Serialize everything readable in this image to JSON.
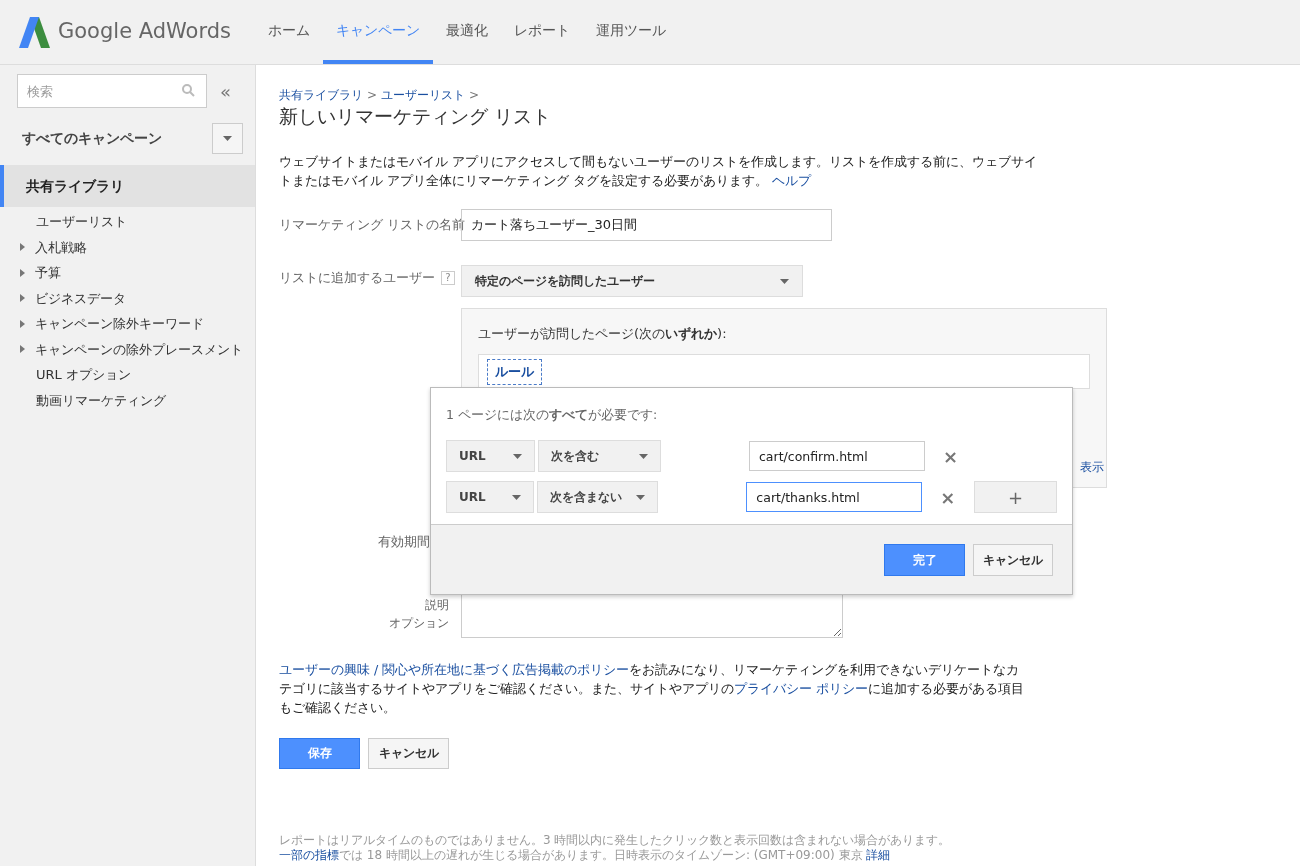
{
  "header": {
    "logo_text": "Google AdWords",
    "tabs": [
      {
        "label": "ホーム",
        "selected": false
      },
      {
        "label": "キャンペーン",
        "selected": true
      },
      {
        "label": "最適化",
        "selected": false
      },
      {
        "label": "レポート",
        "selected": false
      },
      {
        "label": "運用ツール",
        "selected": false
      }
    ]
  },
  "sidebar": {
    "search": {
      "placeholder": "検索"
    },
    "collapse": "«",
    "campaigns": "すべてのキャンペーン",
    "section": {
      "label": "共有ライブラリ",
      "selected": true
    },
    "items": [
      {
        "label": "ユーザーリスト",
        "kind": "leaf"
      },
      {
        "label": "入札戦略",
        "kind": "group"
      },
      {
        "label": "予算",
        "kind": "group"
      },
      {
        "label": "ビジネスデータ",
        "kind": "group"
      },
      {
        "label": "キャンペーン除外キーワード",
        "kind": "group"
      },
      {
        "label": "キャンペーンの除外プレースメント",
        "kind": "group"
      },
      {
        "label": "URL オプション",
        "kind": "leaf"
      },
      {
        "label": "動画リマーケティング",
        "kind": "leaf"
      }
    ]
  },
  "breadcrumb": [
    "共有ライブラリ",
    "ユーザーリスト"
  ],
  "breadcrumb_sep": ">",
  "title": "新しいリマーケティング リスト",
  "intro": {
    "text": "ウェブサイトまたはモバイル アプリにアクセスして間もないユーザーのリストを作成します。リストを作成する前に、ウェブサイトまたはモバイル アプリ全体にリマーケティング タグを設定する必要があります。",
    "link": "ヘルプ"
  },
  "form": {
    "name_label": "リマーケティング リストの名前",
    "name_value": "カート落ちユーザー_30日間",
    "users_label": "リストに追加するユーザー",
    "users_help": "?",
    "users_value": "特定のページを訪問したユーザー",
    "pages_heading": "ユーザーが訪問したページ(次の**いずれか**):",
    "rule_chip": "ルール",
    "pages_link": "表示",
    "duration_label": "有効期間",
    "description_label": "説明",
    "description_note": "オプション"
  },
  "rule_popup": {
    "heading": "1 ページには次の**すべて**が必要です:",
    "rules": [
      {
        "field": "URL",
        "operator": "次を含む",
        "value": "cart/confirm.html",
        "focused": false,
        "remove": "×"
      },
      {
        "field": "URL",
        "operator": "次を含まない",
        "value": "cart/thanks.html",
        "focused": true,
        "remove": "×",
        "add": "+"
      }
    ],
    "done": "完了",
    "cancel": "キャンセル"
  },
  "policy": [
    {
      "text": "ユーザーの興味 / 関心や所在地に基づく広告掲載のポリシー",
      "link": true
    },
    {
      "text": "をお読みになり、リマーケティングを利用できないデリケートなカテゴリに該当するサイトやアプリをご確認ください。また、サイトやアプリの",
      "link": false
    },
    {
      "text": "プライバシー ポリシー",
      "link": true
    },
    {
      "text": "に追加する必要がある項目もご確認ください。",
      "link": false
    }
  ],
  "buttons": {
    "save": "保存",
    "cancel": "キャンセル"
  },
  "footer": {
    "line1": "レポートはリアルタイムのものではありません。3 時間以内に発生したクリック数と表示回数は含まれない場合があります。",
    "line2": [
      {
        "text": "一部の指標",
        "link": true
      },
      {
        "text": "では 18 時間以上の遅れが生じる場合があります。日時表示のタイムゾーン: (GMT+09:00) 東京 ",
        "link": false
      },
      {
        "text": "詳細",
        "link": true
      }
    ]
  }
}
